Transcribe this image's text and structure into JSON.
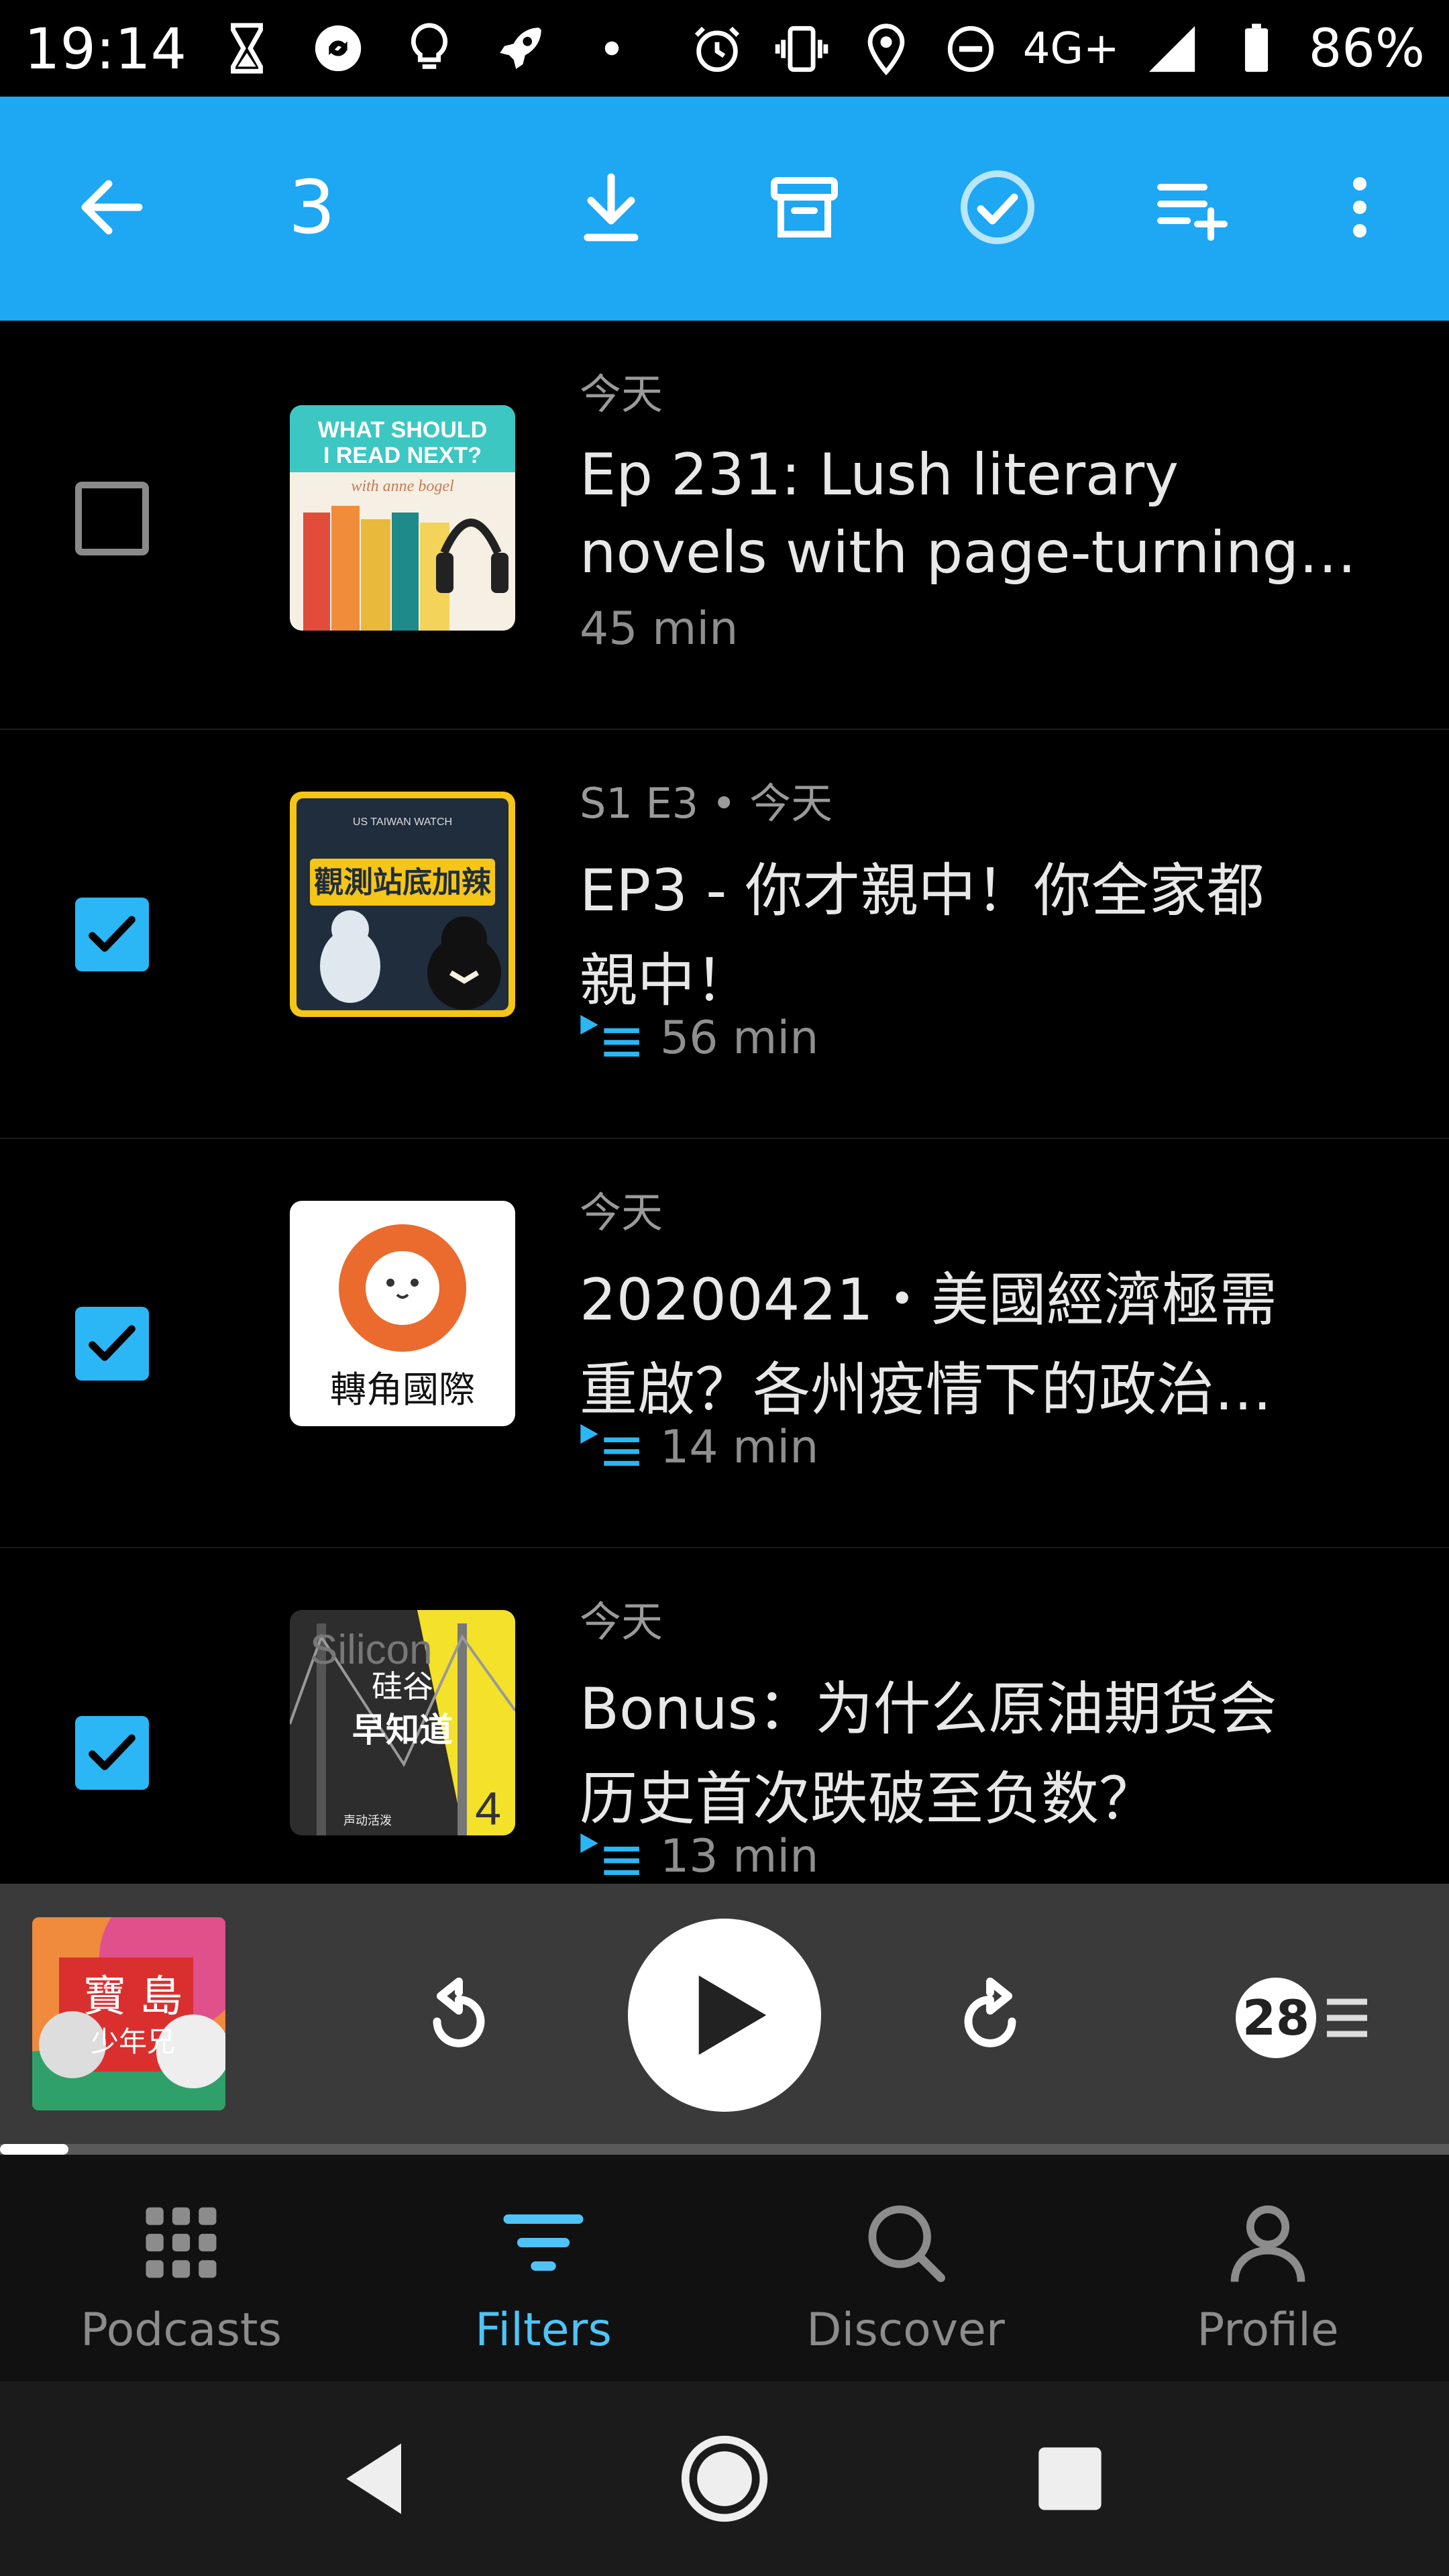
{
  "status_bar": {
    "time": "19:14",
    "network": "4G+",
    "battery": "86%",
    "left_icons": [
      "hourglass-icon",
      "sync-circle-icon",
      "lightbulb-icon",
      "rocket-icon",
      "dot-icon"
    ],
    "right_icons": [
      "alarm-icon",
      "vibrate-icon",
      "location-icon",
      "do-not-disturb-icon",
      "signal-icon",
      "battery-icon"
    ]
  },
  "toolbar": {
    "selected_count": "3",
    "background_color": "#1ea7f3",
    "actions": [
      "back-arrow-icon",
      "download-icon",
      "archive-icon",
      "mark-played-icon",
      "add-to-queue-icon",
      "more-vert-icon"
    ]
  },
  "episodes": [
    {
      "checked": false,
      "meta": "今天",
      "title_lines": [
        "Ep 231: Lush literary",
        "novels with page-turning …"
      ],
      "duration": "45 min",
      "queued": false,
      "art": {
        "name": "what-should-i-read-next-artwork",
        "text_line1": "WHAT SHOULD",
        "text_line2": "I READ NEXT?",
        "text_line3": "with anne bogel"
      }
    },
    {
      "checked": true,
      "meta": "S1 E3 • 今天",
      "title_lines": [
        "EP3 - 你才親中！你全家都",
        "親中！"
      ],
      "duration": "56 min",
      "queued": true,
      "art": {
        "name": "taiwan-watch-artwork",
        "text_top": "US TAIWAN WATCH",
        "text_main": "觀測站底加辣"
      }
    },
    {
      "checked": true,
      "meta": "今天",
      "title_lines": [
        "20200421・美國經濟極需",
        "重啟？各州疫情下的政治…"
      ],
      "duration": "14 min",
      "queued": true,
      "art": {
        "name": "zhuanjiao-guoji-artwork",
        "text_main": "轉角國際"
      }
    },
    {
      "checked": true,
      "meta": "今天",
      "title_lines": [
        "Bonus：为什么原油期货会",
        "历史首次跌破至负数？"
      ],
      "duration": "13 min",
      "queued": true,
      "art": {
        "name": "silicon-valley-artwork",
        "text_bg": "Silicon",
        "text_line1": "硅谷",
        "text_line2": "早知道",
        "text_num": "4",
        "text_small": "声动活泼"
      }
    }
  ],
  "player": {
    "art_text_line1": "寶 島",
    "art_text_line2": "少年兄",
    "skip_back_icon": "rewind-icon",
    "play_icon": "play-icon",
    "skip_forward_icon": "fast-forward-icon",
    "queue_count": "28",
    "progress": 0.047
  },
  "bottom_nav": {
    "items": [
      {
        "label": "Podcasts",
        "icon": "podcasts-grid-icon",
        "active": false
      },
      {
        "label": "Filters",
        "icon": "filters-icon",
        "active": true
      },
      {
        "label": "Discover",
        "icon": "discover-search-icon",
        "active": false
      },
      {
        "label": "Profile",
        "icon": "profile-icon",
        "active": false
      }
    ],
    "active_color": "#4fc3f7"
  },
  "system_nav": [
    "back-triangle-icon",
    "home-circle-icon",
    "recents-square-icon"
  ]
}
